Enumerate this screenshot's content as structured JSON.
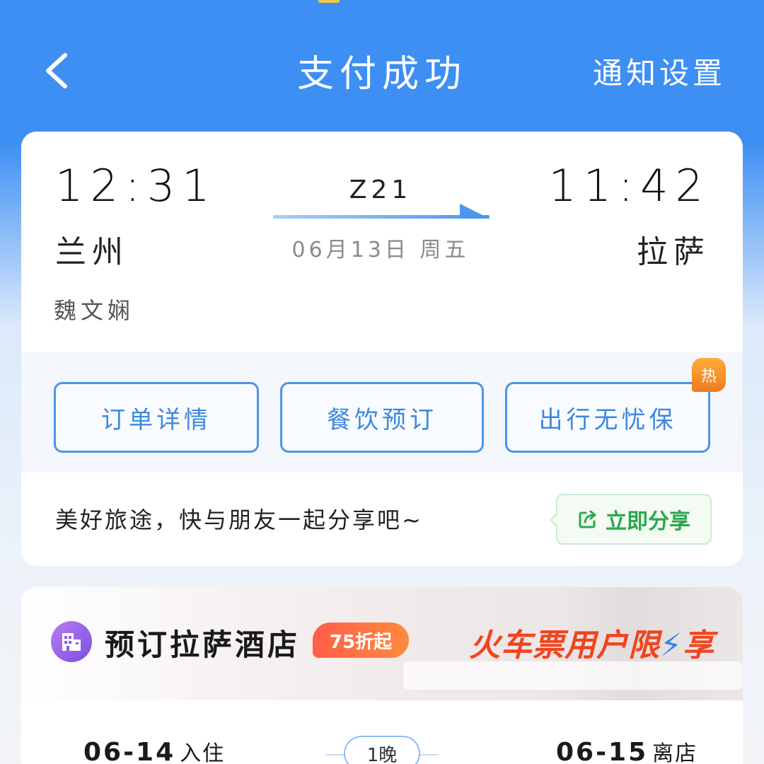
{
  "status_bar": {
    "text": ""
  },
  "header": {
    "title": "支付成功",
    "notify_label": "通知设置"
  },
  "trip": {
    "departure_time": "12:31",
    "arrival_time": "11:42",
    "train_number": "Z21",
    "date": "06月13日 周五",
    "departure_city": "兰州",
    "arrival_city": "拉萨",
    "passenger": "魏文娴"
  },
  "actions": {
    "order_details": "订单详情",
    "meal_booking": "餐饮预订",
    "travel_insurance": "出行无忧保",
    "hot_badge": "热"
  },
  "share": {
    "text": "美好旅途，快与朋友一起分享吧~",
    "button_label": "立即分享"
  },
  "hotel": {
    "title": "预订拉萨酒店",
    "discount": "75折起",
    "promo_prefix": "火车票用户限",
    "promo_suffix": "享",
    "checkin_date": "06-14",
    "checkin_label": "入住",
    "nights": "1晚",
    "checkout_date": "06-15",
    "checkout_label": "离店"
  },
  "colors": {
    "header_blue": "#3d8ff3",
    "action_blue": "#4d95e6",
    "share_green": "#2aa84a",
    "promo_red": "#f0451e",
    "hot_orange": "#f58a24",
    "hotel_icon_purple": "#8b5ce6"
  },
  "icons": {
    "back": "chevron-left-icon",
    "share": "share-icon",
    "hotel": "hotel-building-icon",
    "bolt": "lightning-icon"
  }
}
